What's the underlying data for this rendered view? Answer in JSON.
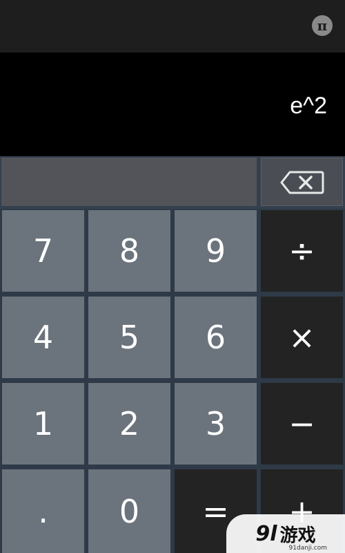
{
  "header": {
    "pi_label": "π"
  },
  "display": {
    "expression": "e^2",
    "input": ""
  },
  "icons": {
    "backspace": "backspace-icon",
    "pi": "pi-icon"
  },
  "keys": {
    "seven": "7",
    "eight": "8",
    "nine": "9",
    "divide": "÷",
    "four": "4",
    "five": "5",
    "six": "6",
    "multiply": "×",
    "one": "1",
    "two": "2",
    "three": "3",
    "minus": "−",
    "decimal": ".",
    "zero": "0",
    "equals": "=",
    "plus": "+"
  },
  "watermark": {
    "logo": "9l",
    "text": "游戏",
    "url": "91danji.com"
  },
  "colors": {
    "number_key": "#6b737c",
    "operator_key": "#232323",
    "display_bg": "#000000",
    "grid_bg": "#2e3a47"
  }
}
